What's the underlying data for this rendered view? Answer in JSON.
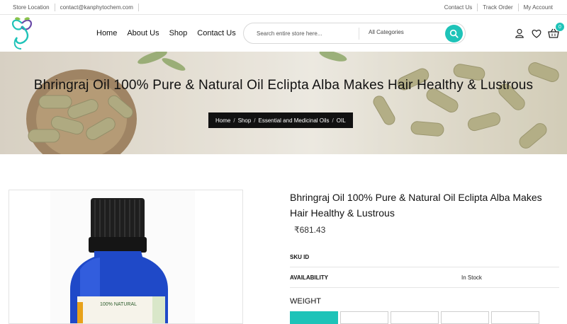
{
  "topbar": {
    "left_links": [
      "Store Location",
      "contact@kanphytochem.com"
    ],
    "right_links": [
      "Contact Us",
      "Track Order",
      "My Account"
    ]
  },
  "nav": {
    "items": [
      "Home",
      "About Us",
      "Shop",
      "Contact Us"
    ]
  },
  "search": {
    "placeholder": "Search entire store here...",
    "category": "All Categories"
  },
  "cart": {
    "count": "0"
  },
  "banner": {
    "title": "Bhringraj Oil 100% Pure & Natural Oil Eclipta Alba Makes Hair Healthy & Lustrous",
    "breadcrumb": [
      "Home",
      "Shop",
      "Essential and Medicinal Oils",
      "OIL"
    ]
  },
  "product": {
    "title": "Bhringraj Oil 100% Pure & Natural Oil Eclipta Alba Makes Hair Healthy & Lustrous",
    "price": "₹681.43",
    "bottle_label": "100% NATURAL",
    "rows": [
      {
        "label": "SKU ID",
        "value": ""
      },
      {
        "label": "AVAILABILITY",
        "value": "In Stock"
      }
    ],
    "weight_label": "WEIGHT",
    "weight_options": [
      "",
      "",
      "",
      "",
      ""
    ]
  },
  "colors": {
    "accent": "#1ec3b8",
    "crumb_bg": "#111111"
  }
}
